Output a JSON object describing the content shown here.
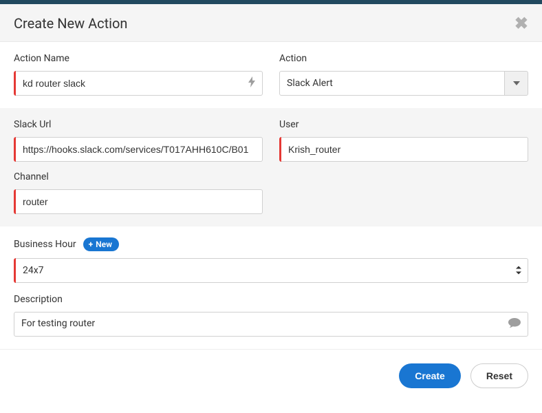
{
  "modal": {
    "title": "Create New Action"
  },
  "fields": {
    "action_name": {
      "label": "Action Name",
      "value": "kd router slack"
    },
    "action": {
      "label": "Action",
      "value": "Slack Alert"
    },
    "slack_url": {
      "label": "Slack Url",
      "value": "https://hooks.slack.com/services/T017AHH610C/B01"
    },
    "user": {
      "label": "User",
      "value": "Krish_router"
    },
    "channel": {
      "label": "Channel",
      "value": "router"
    },
    "business_hour": {
      "label": "Business Hour",
      "new_label": "New",
      "value": "24x7"
    },
    "description": {
      "label": "Description",
      "value": "For testing router"
    }
  },
  "buttons": {
    "create": "Create",
    "reset": "Reset"
  }
}
